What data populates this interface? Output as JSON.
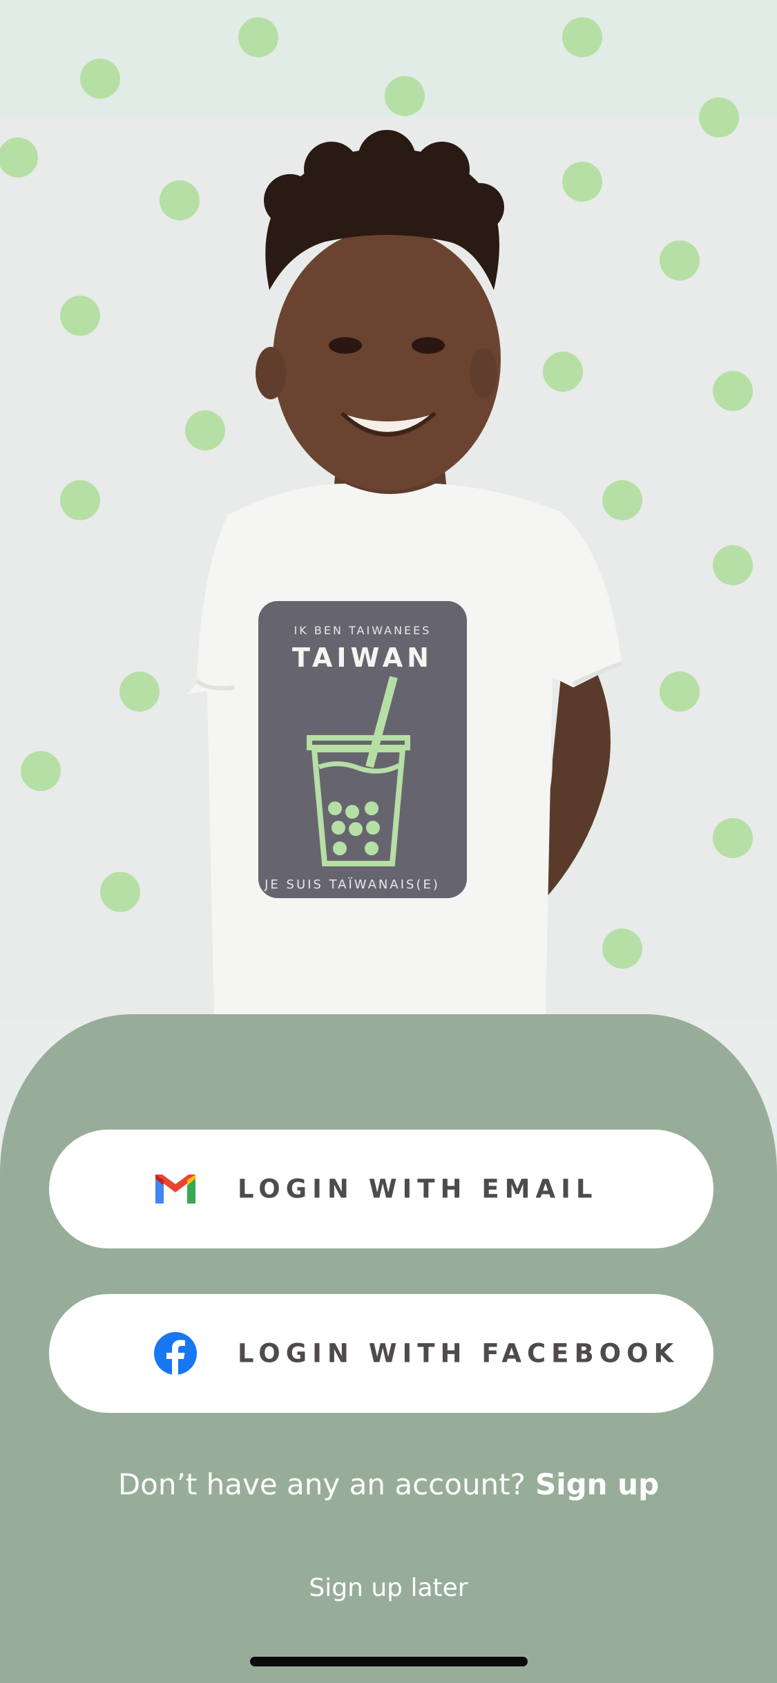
{
  "hero": {
    "shirt": {
      "top_text": "IK BEN TAIWANEES",
      "title": "TAIWAN",
      "bottom_text": "JE SUIS TAÏWANAIS(E)"
    }
  },
  "login": {
    "email_label": "LOGIN WITH EMAIL",
    "facebook_label": "LOGIN WITH FACEBOOK"
  },
  "signup": {
    "prompt": "Don’t have any an account?",
    "link": "Sign up",
    "later": "Sign up later"
  },
  "icons": {
    "email": "gmail-icon",
    "facebook": "facebook-icon"
  },
  "colors": {
    "panel": "#98ad99",
    "dots": "#b6dfa5",
    "facebook_blue": "#1877f2",
    "button_text": "#4f4a4b"
  }
}
